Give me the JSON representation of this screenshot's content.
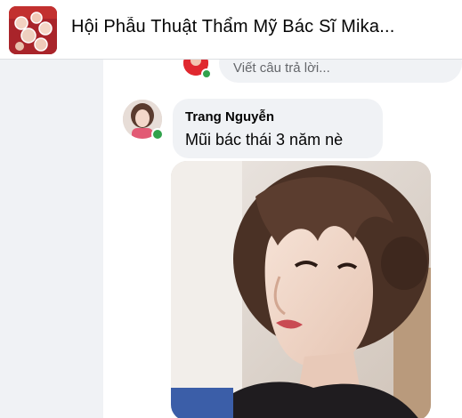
{
  "header": {
    "group_title": "Hội Phẫu Thuật Thẩm Mỹ Bác Sĩ Mika...",
    "group_thumbnail_icon": "group-cover-image"
  },
  "reply": {
    "placeholder": "Viết câu trả lời..."
  },
  "comment": {
    "author": "Trang Nguyễn",
    "text": "Mũi bác thái 3 năm nè",
    "online": true
  },
  "photo": {
    "icon": "portrait-photo"
  },
  "colors": {
    "online": "#31a24c",
    "bubble": "#f0f2f5",
    "feed_background": "#f0f2f5"
  }
}
